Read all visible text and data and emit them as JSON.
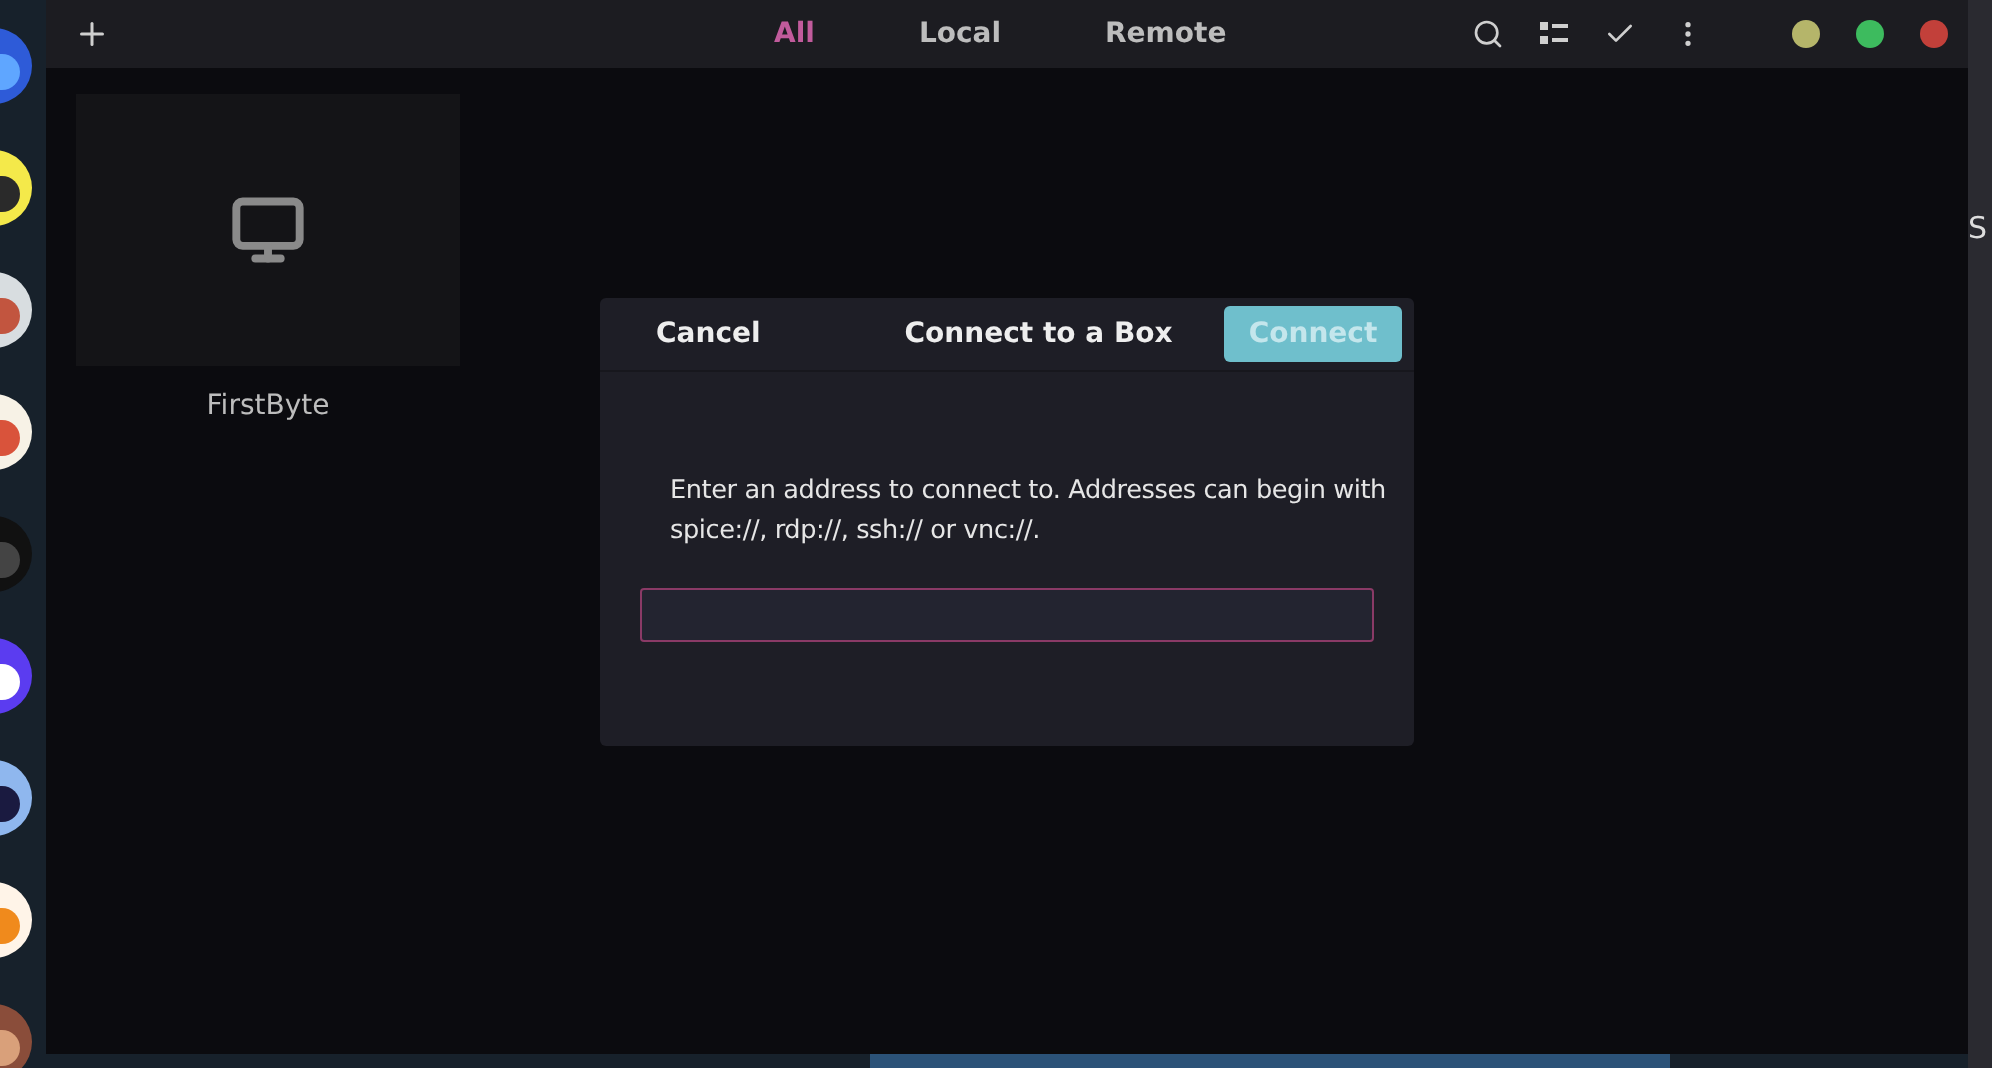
{
  "header": {
    "tabs": [
      {
        "label": "All",
        "selected": true
      },
      {
        "label": "Local",
        "selected": false
      },
      {
        "label": "Remote",
        "selected": false
      }
    ]
  },
  "boxes": [
    {
      "name": "FirstByte"
    }
  ],
  "dialog": {
    "cancel": "Cancel",
    "title": "Connect to a Box",
    "connect": {
      "label": "Connect",
      "disabled": true
    },
    "message": "Enter an address to connect to. Addresses can begin with spice://, rdp://, ssh:// or vnc://."
  },
  "side_window": {
    "text": "S"
  }
}
